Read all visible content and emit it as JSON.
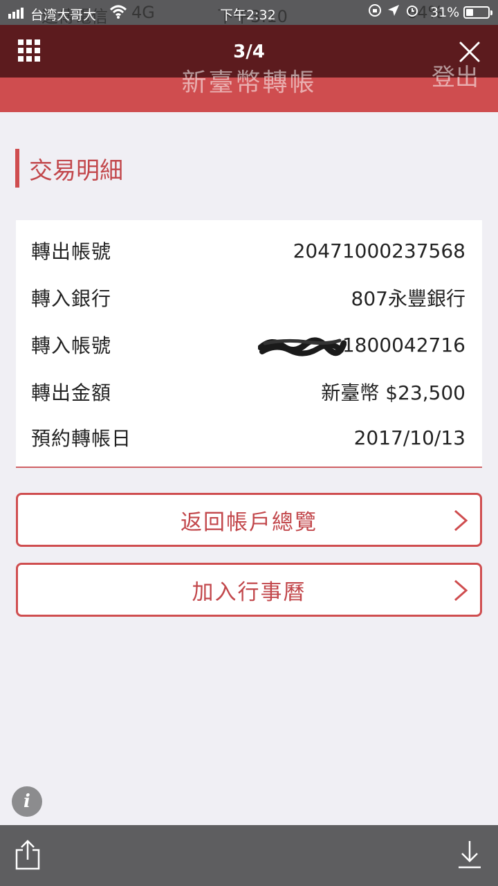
{
  "status_bar": {
    "carrier": "台湾大哥大",
    "time": "下午2:32",
    "battery": "31%",
    "ghost_carrier": "遠傳電信",
    "ghost_network": "4G",
    "ghost_time": "下午3:10",
    "ghost_battery": "64%"
  },
  "viewer": {
    "counter": "3/4"
  },
  "app_header": {
    "title": "新臺幣轉帳",
    "logout": "登出"
  },
  "section": {
    "title": "交易明細"
  },
  "details": [
    {
      "label": "轉出帳號",
      "value": "20471000237568"
    },
    {
      "label": "轉入銀行",
      "value": "807永豐銀行"
    },
    {
      "label": "轉入帳號",
      "value": "1800042716"
    },
    {
      "label": "轉出金額",
      "value": "新臺幣 $23,500"
    },
    {
      "label": "預約轉帳日",
      "value": "2017/10/13"
    }
  ],
  "buttons": {
    "back_to_overview": "返回帳戶總覽",
    "add_to_calendar": "加入行事曆"
  },
  "colors": {
    "accent": "#cf4d4f",
    "viewer_bar": "#5c1b1e",
    "background": "#f0eff4"
  },
  "icons": {
    "menu": "grid-icon",
    "close": "close-icon",
    "info": "info-icon",
    "share": "share-icon",
    "download": "download-icon",
    "chevron": "chevron-right-icon"
  }
}
